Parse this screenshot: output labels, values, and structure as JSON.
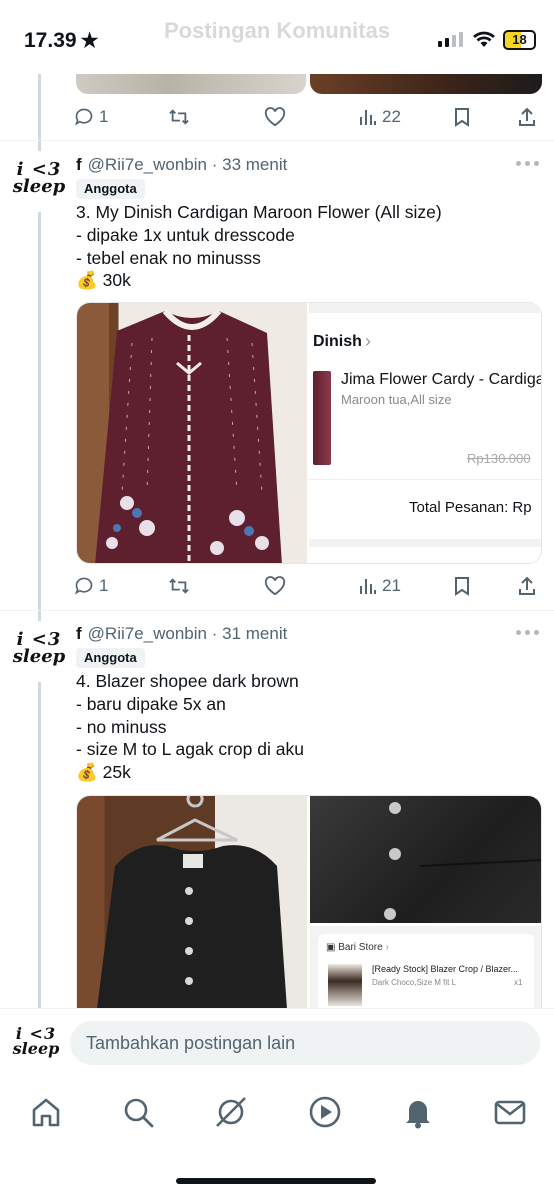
{
  "status_bar": {
    "time": "17.39",
    "page_title_faded": "Postingan Komunitas",
    "battery": "18"
  },
  "previous_post_actions": {
    "replies": "1",
    "views": "22"
  },
  "posts": [
    {
      "name": "f",
      "handle": "@Rii7e_wonbin",
      "time": "· 33 menit",
      "badge": "Anggota",
      "text": "3. My Dinish Cardigan Maroon Flower (All size)\n- dipake 1x untuk dresscode\n- tebel enak no minusss\n💰 30k",
      "receipt": {
        "store": "Dinish",
        "product": "Jima Flower Cardy - Cardigan",
        "variant": "Maroon tua,All size",
        "old_price": "Rp130.000",
        "total_label": "Total Pesanan: Rp"
      },
      "replies": "1",
      "views": "21"
    },
    {
      "name": "f",
      "handle": "@Rii7e_wonbin",
      "time": "· 31 menit",
      "badge": "Anggota",
      "text": "4. Blazer shopee dark brown\n- baru dipake 5x an\n- no minuss\n- size M to L agak crop di aku\n💰 25k",
      "receipt": {
        "store": "Bari Store",
        "product": "[Ready Stock] Blazer Crop / Blazer...",
        "variant": "Dark Choco,Size M fit L",
        "qty": "x1"
      }
    }
  ],
  "avatar": {
    "line1": "i <3",
    "line2": "sleep"
  },
  "composer": {
    "placeholder": "Tambahkan postingan lain"
  },
  "tabs": [
    "home-icon",
    "search-icon",
    "grok-icon",
    "video-icon",
    "notifications-icon",
    "messages-icon"
  ],
  "colors": {
    "cardigan": "#5e1f2e",
    "blazer": "#1f1f1f",
    "wood": "#7a4a2e",
    "accent_gray": "#536471"
  }
}
